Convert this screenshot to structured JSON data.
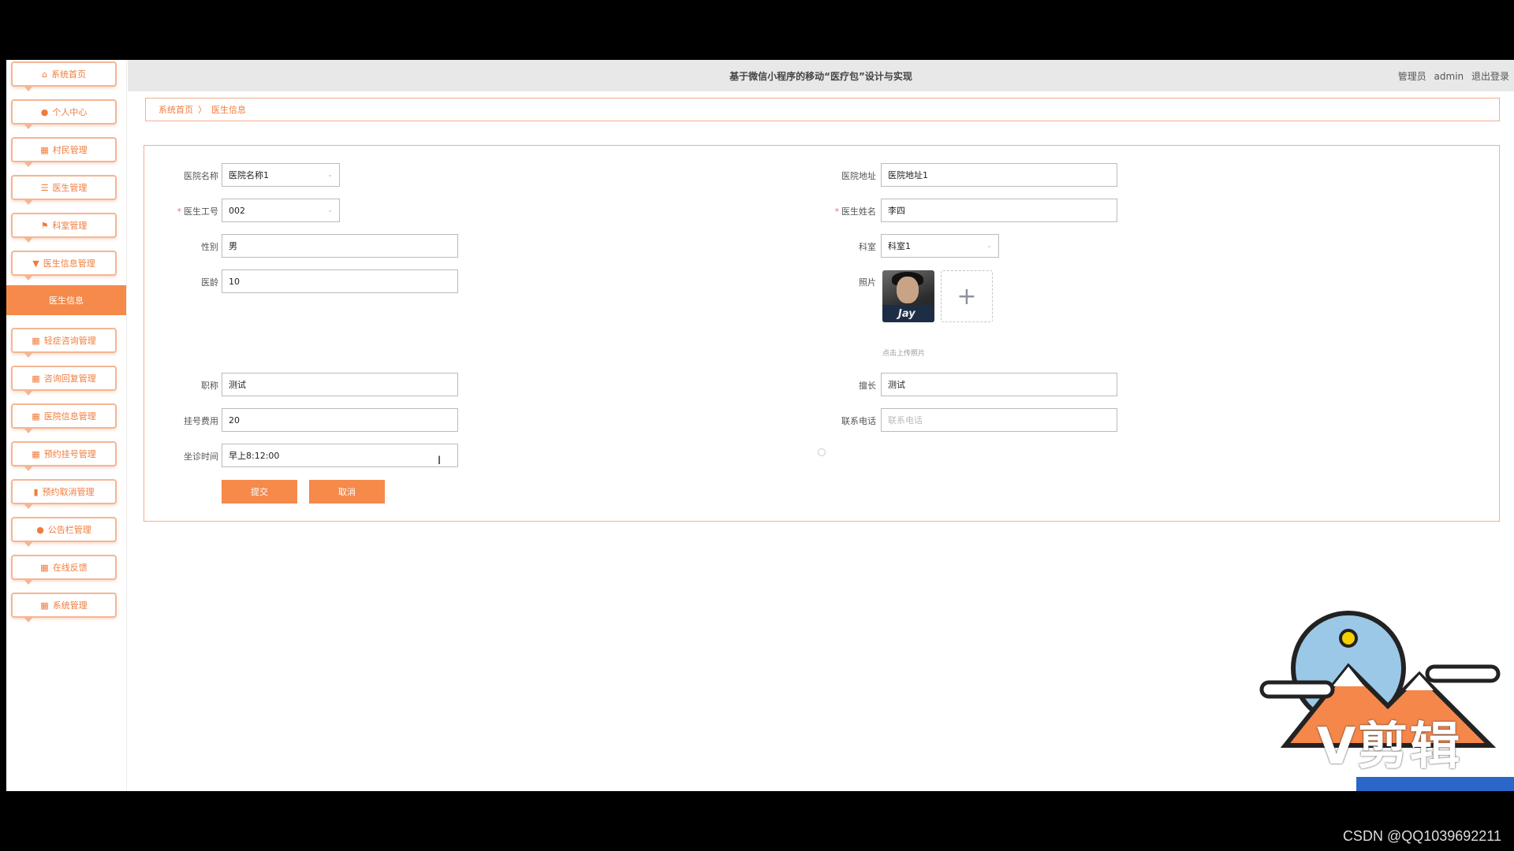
{
  "header": {
    "title": "基于微信小程序的移动“医疗包”设计与实现",
    "role": "管理员",
    "username": "admin",
    "logout": "退出登录"
  },
  "breadcrumb": {
    "home": "系统首页",
    "current": "医生信息"
  },
  "sidebar": {
    "items": [
      {
        "label": "系统首页",
        "icon": "home-icon"
      },
      {
        "label": "个人中心",
        "icon": "user-icon"
      },
      {
        "label": "村民管理",
        "icon": "grid-icon"
      },
      {
        "label": "医生管理",
        "icon": "list-icon"
      },
      {
        "label": "科室管理",
        "icon": "flag-icon"
      },
      {
        "label": "医生信息管理",
        "icon": "pin-icon"
      },
      {
        "label": "轻症咨询管理",
        "icon": "grid-icon"
      },
      {
        "label": "咨询回复管理",
        "icon": "grid-icon"
      },
      {
        "label": "医院信息管理",
        "icon": "grid-icon"
      },
      {
        "label": "预约挂号管理",
        "icon": "grid-icon"
      },
      {
        "label": "预约取消管理",
        "icon": "chart-icon"
      },
      {
        "label": "公告栏管理",
        "icon": "location-icon"
      },
      {
        "label": "在线反馈",
        "icon": "grid-icon"
      },
      {
        "label": "系统管理",
        "icon": "grid-icon"
      }
    ],
    "active": "医生信息"
  },
  "form": {
    "hospital_name": {
      "label": "医院名称",
      "value": "医院名称1"
    },
    "hospital_address": {
      "label": "医院地址",
      "value": "医院地址1"
    },
    "doctor_id": {
      "label": "医生工号",
      "value": "002"
    },
    "doctor_name": {
      "label": "医生姓名",
      "value": "李四"
    },
    "gender": {
      "label": "性别",
      "value": "男"
    },
    "department": {
      "label": "科室",
      "value": "科室1"
    },
    "years": {
      "label": "医龄",
      "value": "10"
    },
    "photo": {
      "label": "照片",
      "caption": "Jay",
      "hint": "点击上传照片"
    },
    "title": {
      "label": "职称",
      "value": "测试"
    },
    "specialty": {
      "label": "擅长",
      "value": "测试"
    },
    "fee": {
      "label": "挂号费用",
      "value": "20"
    },
    "phone": {
      "label": "联系电话",
      "placeholder": "联系电话"
    },
    "schedule": {
      "label": "坐诊时间",
      "value": "早上8:12:00"
    },
    "submit": "提交",
    "cancel": "取消"
  },
  "overlay": {
    "watermark": "V剪辑",
    "credit": "CSDN @QQ1039692211"
  },
  "colors": {
    "accent": "#f58a4b",
    "border": "#f3b08c"
  }
}
